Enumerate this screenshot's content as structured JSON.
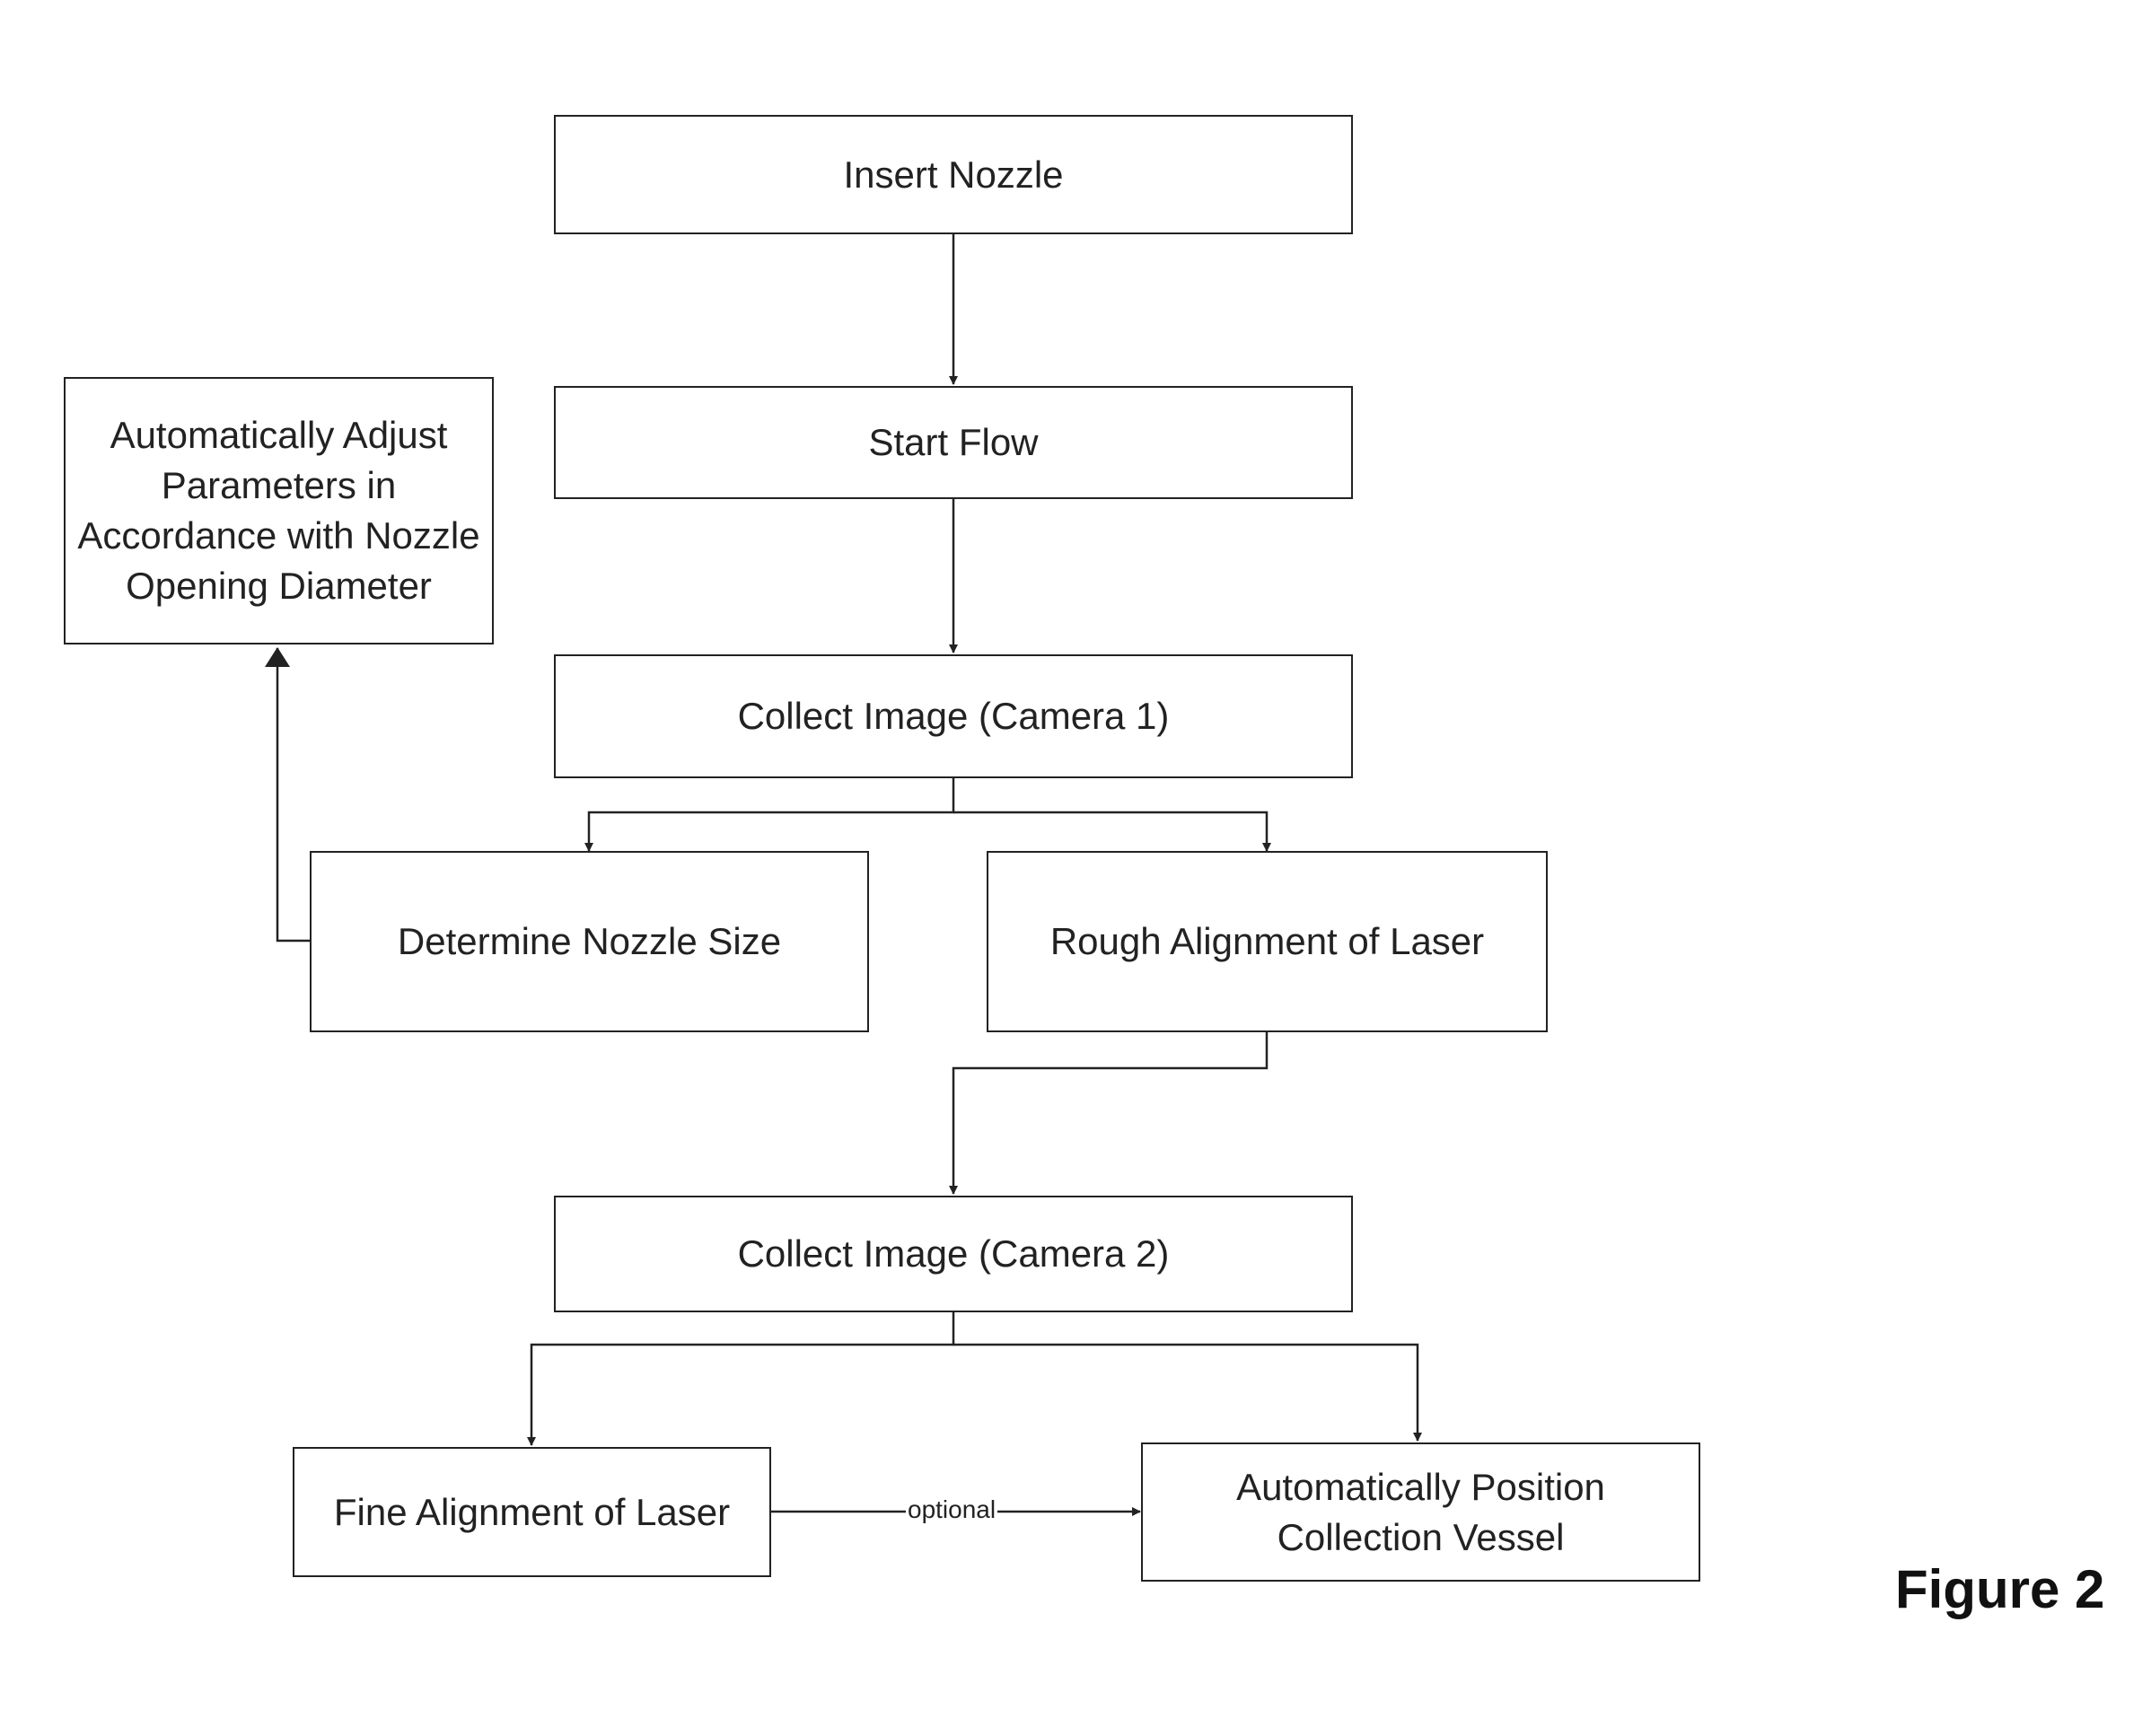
{
  "figure_label": "Figure 2",
  "nodes": {
    "insert_nozzle": "Insert Nozzle",
    "start_flow": "Start Flow",
    "collect_image_1": "Collect Image (Camera 1)",
    "determine_nozzle_size": "Determine Nozzle Size",
    "rough_alignment": "Rough Alignment of Laser",
    "auto_adjust": "Automatically Adjust Parameters in Accordance with Nozzle Opening Diameter",
    "collect_image_2": "Collect Image (Camera 2)",
    "fine_alignment": "Fine Alignment of Laser",
    "auto_position": "Automatically Position Collection Vessel"
  },
  "edges": [
    {
      "from": "insert_nozzle",
      "to": "start_flow"
    },
    {
      "from": "start_flow",
      "to": "collect_image_1"
    },
    {
      "from": "collect_image_1",
      "to": "determine_nozzle_size"
    },
    {
      "from": "collect_image_1",
      "to": "rough_alignment"
    },
    {
      "from": "determine_nozzle_size",
      "to": "auto_adjust"
    },
    {
      "from": "rough_alignment",
      "to": "collect_image_2"
    },
    {
      "from": "collect_image_2",
      "to": "fine_alignment"
    },
    {
      "from": "collect_image_2",
      "to": "auto_position"
    },
    {
      "from": "fine_alignment",
      "to": "auto_position",
      "label": "optional"
    }
  ],
  "edge_label_optional": "optional"
}
